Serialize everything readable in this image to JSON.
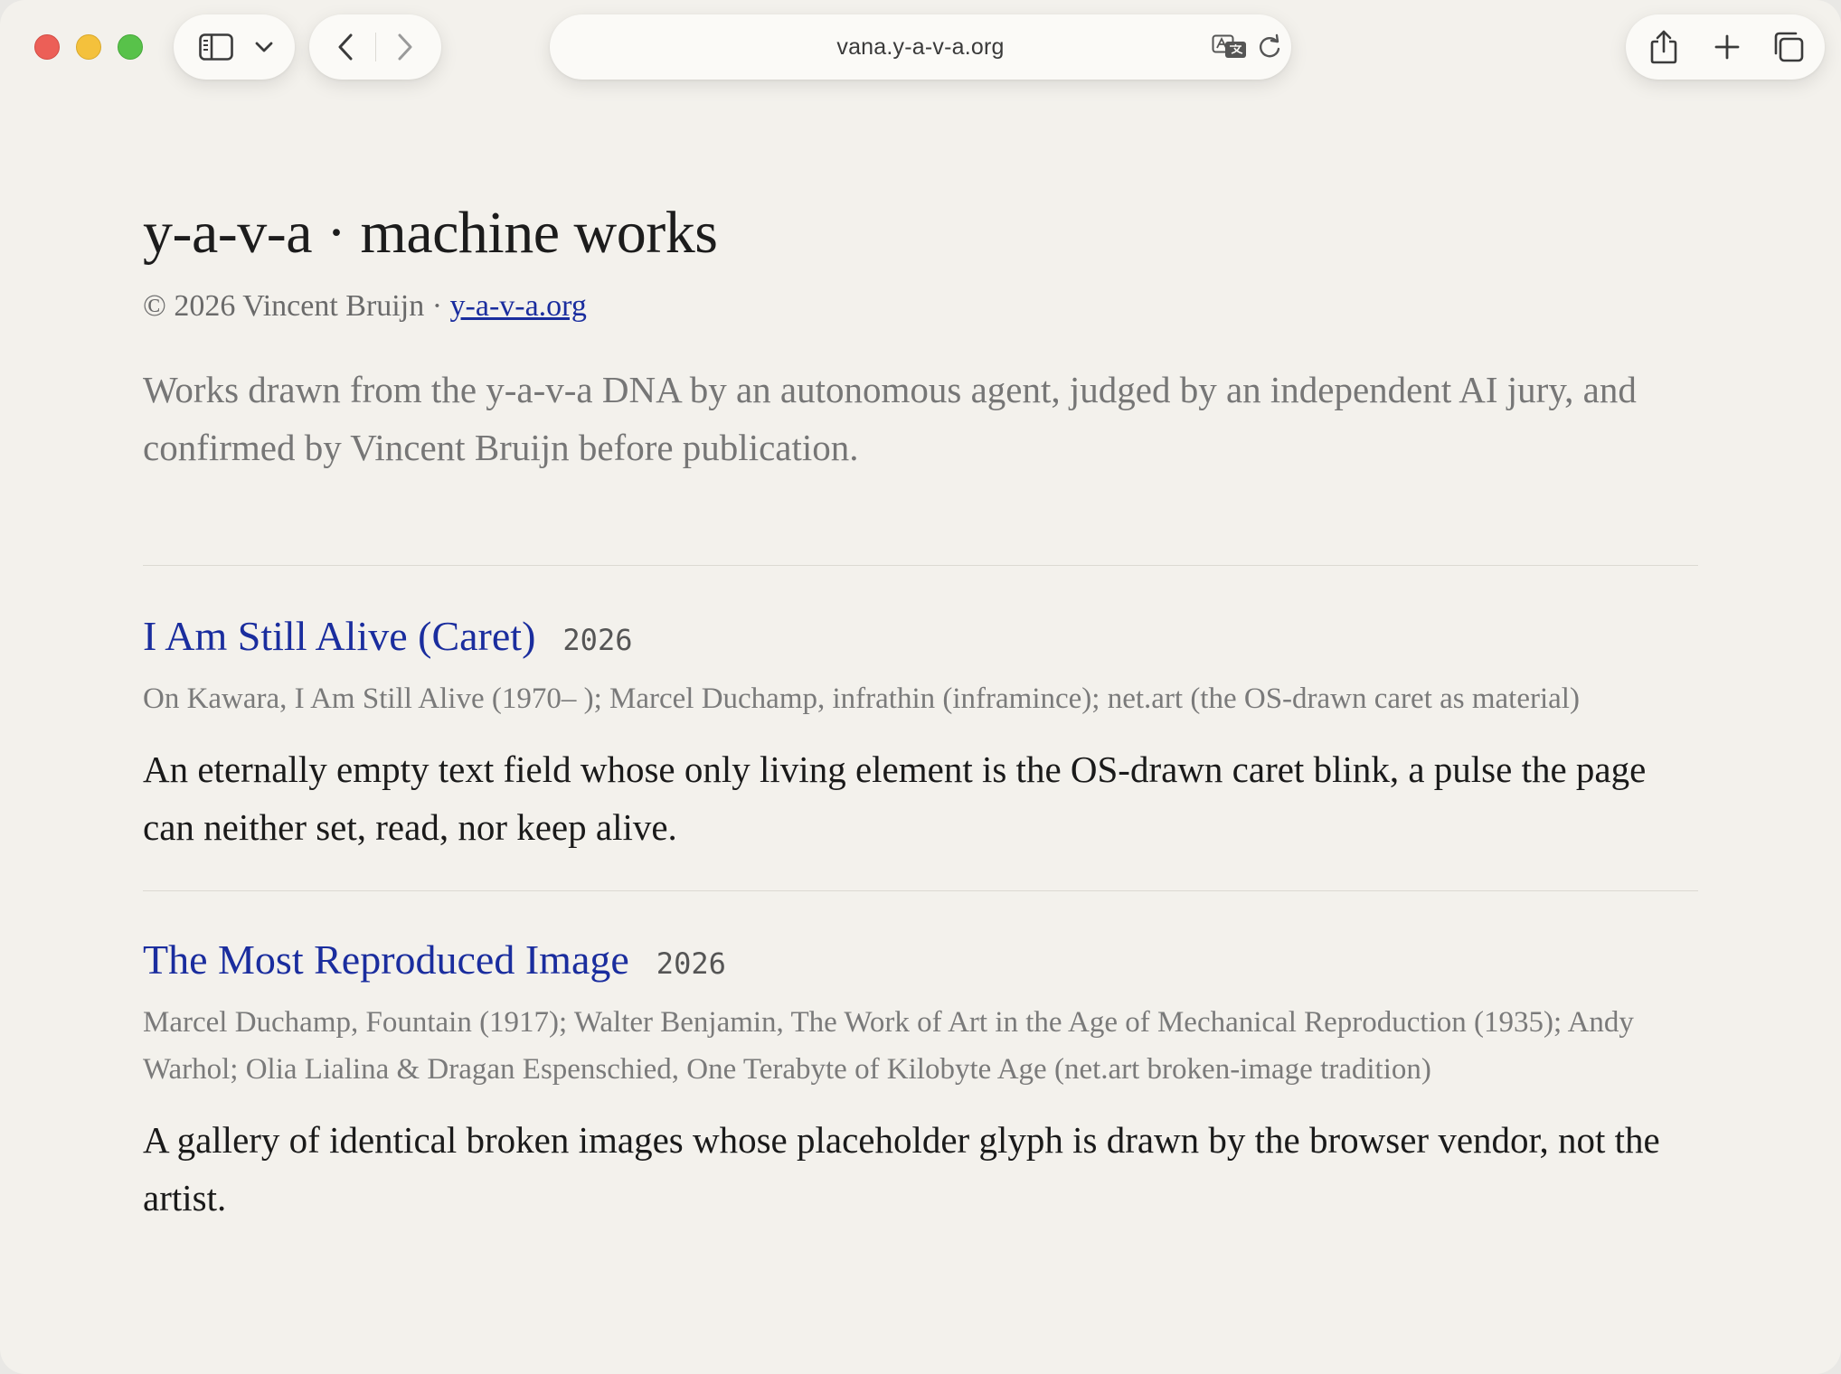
{
  "browser": {
    "url": "vana.y-a-v-a.org",
    "icons": {
      "sidebar": "sidebar-icon",
      "sidebar_menu": "chevron-down-icon",
      "back": "chevron-left-icon",
      "forward": "chevron-right-icon",
      "translate": "translate-icon",
      "reload": "reload-icon",
      "share": "share-icon",
      "new_tab": "plus-icon",
      "tabs": "tabs-overview-icon"
    },
    "colors": {
      "close": "#ec5f57",
      "minimize": "#f4c13c",
      "zoom": "#58c24a"
    }
  },
  "page": {
    "title": "y-a-v-a · machine works",
    "byline_prefix": "© 2026 Vincent Bruijn · ",
    "byline_link": "y-a-v-a.org",
    "intro": "Works drawn from the y-a-v-a DNA by an autonomous agent, judged by an independent AI jury, and confirmed by Vincent Bruijn before publication.",
    "link_color": "#1a2d9e",
    "works": [
      {
        "title": "I Am Still Alive (Caret)",
        "year": "2026",
        "refs": "On Kawara, I Am Still Alive (1970– ); Marcel Duchamp, infrathin (inframince); net.art (the OS-drawn caret as material)",
        "description": "An eternally empty text field whose only living element is the OS-drawn caret blink, a pulse the page can neither set, read, nor keep alive."
      },
      {
        "title": "The Most Reproduced Image",
        "year": "2026",
        "refs": "Marcel Duchamp, Fountain (1917); Walter Benjamin, The Work of Art in the Age of Mechanical Reproduction (1935); Andy Warhol; Olia Lialina & Dragan Espenschied, One Terabyte of Kilobyte Age (net.art broken-image tradition)",
        "description": "A gallery of identical broken images whose placeholder glyph is drawn by the browser vendor, not the artist."
      }
    ]
  }
}
